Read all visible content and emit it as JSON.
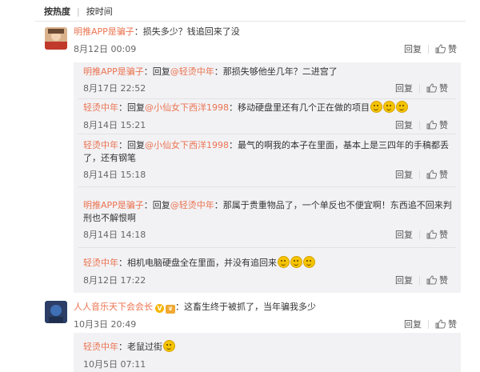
{
  "sort": {
    "hot": "按热度",
    "time": "按时间"
  },
  "comments": [
    {
      "user": "明推APP是骗子",
      "separator": "：",
      "text": "损失多少？钱追回来了没",
      "time": "8月12日 00:09",
      "reply_label": "回复",
      "like_label": "赞"
    },
    {
      "user": "人人音乐天下会会长",
      "separator": "：",
      "text": "这畜生终于被抓了，当年骗我多少",
      "time": "10月3日 20:49",
      "reply_label": "回复",
      "like_label": "赞"
    }
  ],
  "replies": [
    {
      "user": "明推APP是骗子",
      "prefix": "：回复",
      "mention": "@轻烫中年",
      "line1": "：那损失够他坐几年？二进宫了",
      "line2": "",
      "time": "8月17日 22:52",
      "reply_label": "回复",
      "like_label": "赞"
    },
    {
      "user": "轻烫中年",
      "prefix": "：回复",
      "mention": "@小仙女下西洋1998",
      "line1": "：移动硬盘里还有几个正在做的项目",
      "line2": "",
      "time": "8月14日 15:21",
      "reply_label": "回复",
      "like_label": "赞"
    },
    {
      "user": "轻烫中年",
      "prefix": "：回复",
      "mention": "@小仙女下西洋1998",
      "line1": "：最气的啊我的本子在里面，基本上是三四年的手稿都丢",
      "line2": "了，还有钢笔",
      "time": "8月14日 15:18",
      "reply_label": "回复",
      "like_label": "赞"
    },
    {
      "user": "明推APP是骗子",
      "prefix": "：回复",
      "mention": "@轻烫中年",
      "line1": "：那属于贵重物品了，一个单反也不便宜啊！东西追不回来判",
      "line2": "刑也不解恨啊",
      "time": "8月14日 14:18",
      "reply_label": "回复",
      "like_label": "赞"
    },
    {
      "user": "轻烫中年",
      "prefix": "",
      "mention": "",
      "line1": "：相机电脑硬盘全在里面，并没有追回来",
      "line2": "",
      "time": "8月12日 17:22",
      "reply_label": "回复",
      "like_label": "赞"
    },
    {
      "user": "轻烫中年",
      "prefix": "",
      "mention": "",
      "line1": "：老鼠过街",
      "line2": "",
      "time": "10月5日 07:11",
      "reply_label": "",
      "like_label": ""
    }
  ],
  "colors": {
    "username": "#eb7350",
    "panel": "#f2f2f5",
    "text": "#333333"
  },
  "icons": {
    "like": "thumbs-up-icon",
    "emoji": "laughing-tears-emoji"
  }
}
